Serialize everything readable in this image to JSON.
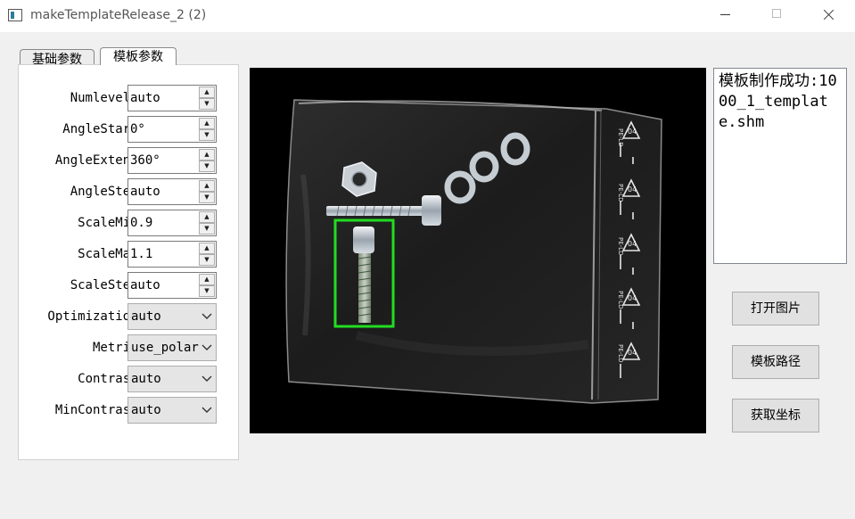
{
  "window": {
    "title": "makeTemplateRelease_2 (2)"
  },
  "tabs": [
    {
      "label": "基础参数",
      "active": false
    },
    {
      "label": "模板参数",
      "active": true
    }
  ],
  "params": [
    {
      "label": "Numlevels:",
      "value": "auto",
      "control": "spinbox"
    },
    {
      "label": "AngleStart:",
      "value": "0°",
      "control": "spinbox"
    },
    {
      "label": "AngleExtent:",
      "value": "360°",
      "control": "spinbox"
    },
    {
      "label": "AngleStep:",
      "value": "auto",
      "control": "spinbox"
    },
    {
      "label": "ScaleMin:",
      "value": "0.9",
      "control": "spinbox"
    },
    {
      "label": "ScaleMax:",
      "value": "1.1",
      "control": "spinbox"
    },
    {
      "label": "ScaleStep:",
      "value": "auto",
      "control": "spinbox"
    },
    {
      "label": "Optimization:",
      "value": "auto",
      "control": "combo"
    },
    {
      "label": "Metric:",
      "value": "use_polar",
      "control": "combo"
    },
    {
      "label": "Contrast:",
      "value": "auto",
      "control": "combo"
    },
    {
      "label": "MinContrast:",
      "value": "auto",
      "control": "combo"
    }
  ],
  "image_view": {
    "bag_marking_code": "04",
    "bag_marking_material": "PE-LD",
    "selection_color": "#22dd22"
  },
  "result": {
    "text": "模板制作成功:1000_1_template.shm"
  },
  "buttons": {
    "open_image": "打开图片",
    "template_path": "模板路径",
    "get_coords": "获取坐标"
  },
  "colors": {
    "window_bg": "#f0f0f0",
    "image_bg": "#000000",
    "button_bg": "#e1e1e1"
  }
}
